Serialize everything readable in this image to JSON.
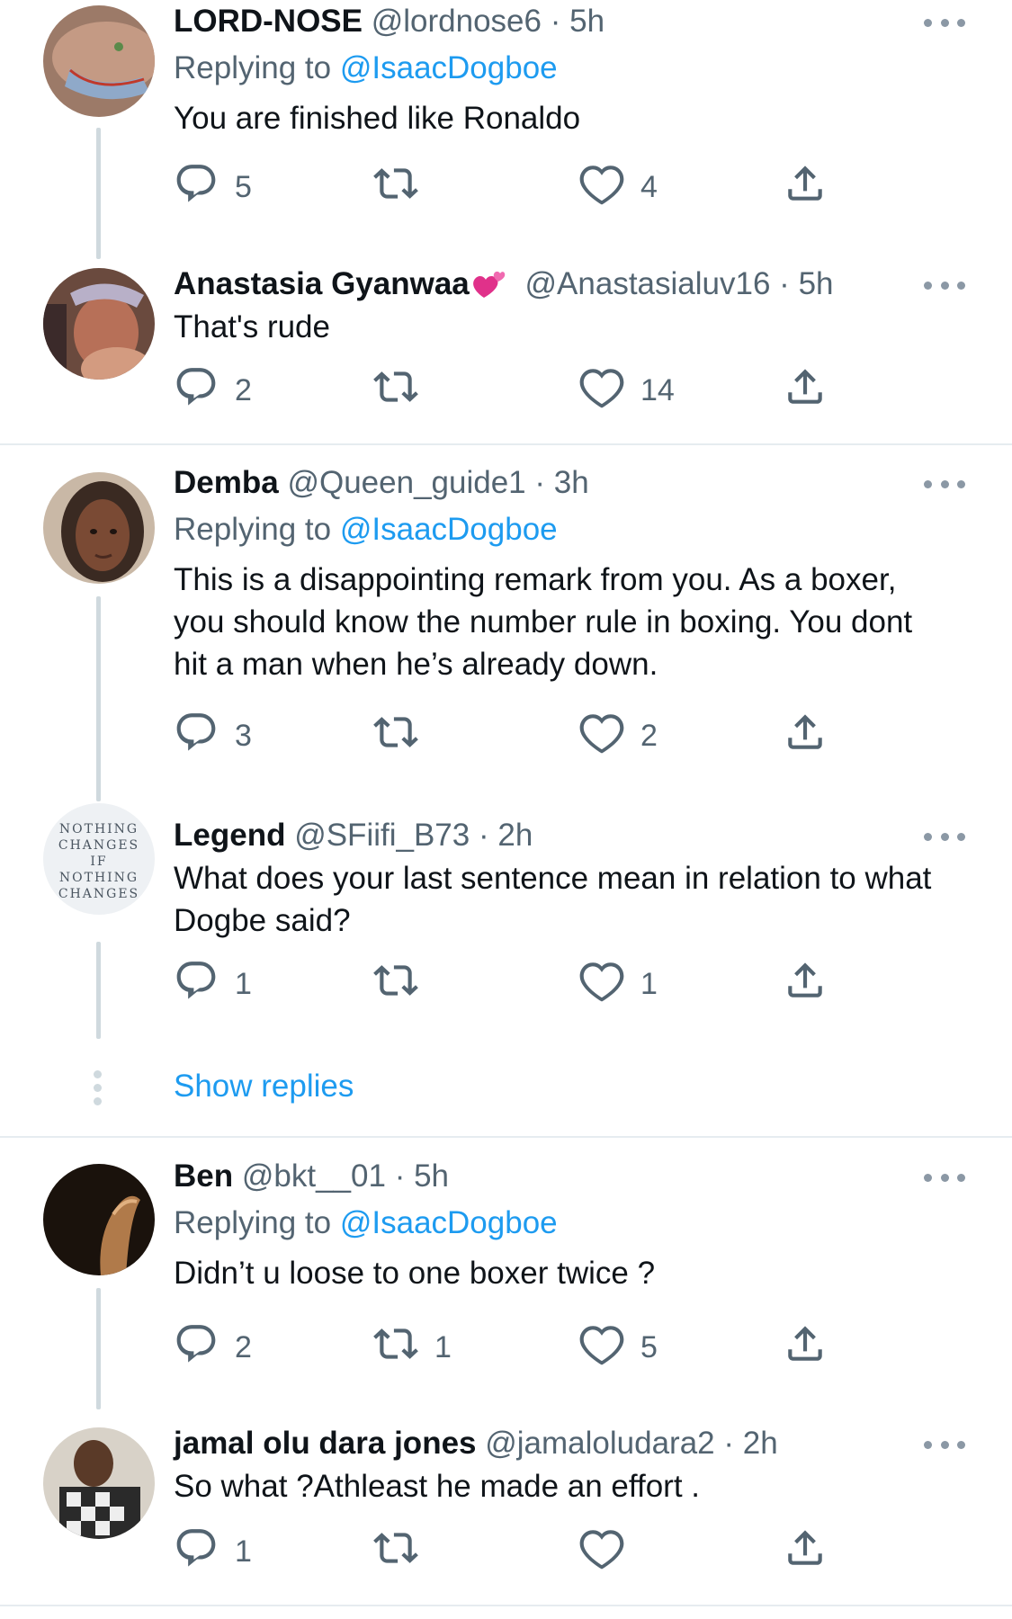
{
  "colors": {
    "accent": "#1d9bf0",
    "secondary_text": "#536471",
    "line": "#cfd9de"
  },
  "icons": {
    "reply": "reply-icon",
    "retweet": "retweet-icon",
    "like": "heart-icon",
    "share": "share-icon",
    "more": "more-icon"
  },
  "tweets": [
    {
      "name": "LORD-NOSE",
      "handle": "@lordnose6",
      "time": "5h",
      "replying_prefix": "Replying to",
      "replying_to": "@IsaacDogboe",
      "text": "You are finished like Ronaldo",
      "replies": "5",
      "retweets": "",
      "likes": "4"
    },
    {
      "name": "Anastasia Gyanwaa",
      "handle": "@Anastasialuv16",
      "time": "5h",
      "text": "That's rude",
      "replies": "2",
      "retweets": "",
      "likes": "14"
    },
    {
      "name": "Demba",
      "handle": "@Queen_guide1",
      "time": "3h",
      "replying_prefix": "Replying to",
      "replying_to": "@IsaacDogboe",
      "text_lines": [
        "This is a disappointing remark from you. As a boxer,",
        "you should know the number rule in boxing. You dont",
        "hit a man when he’s already down."
      ],
      "replies": "3",
      "retweets": "",
      "likes": "2"
    },
    {
      "name": "Legend",
      "handle": "@SFiifi_B73",
      "time": "2h",
      "text_lines": [
        "What does your last sentence mean in relation to what",
        "Dogbe said?"
      ],
      "avatar_text": [
        "NOTHING",
        "CHANGES",
        "IF",
        "NOTHING",
        "CHANGES"
      ],
      "replies": "1",
      "retweets": "",
      "likes": "1"
    },
    {
      "name": "Ben",
      "handle": "@bkt__01",
      "time": "5h",
      "replying_prefix": "Replying to",
      "replying_to": "@IsaacDogboe",
      "text": "Didn’t u loose to one boxer twice ?",
      "replies": "2",
      "retweets": "1",
      "likes": "5"
    },
    {
      "name": "jamal olu dara jones",
      "handle": "@jamaloludara2",
      "time": "2h",
      "text": "So what ?Athleast he made an effort .",
      "replies": "1",
      "retweets": "",
      "likes": ""
    }
  ],
  "show_replies": "Show replies",
  "separator": "·"
}
